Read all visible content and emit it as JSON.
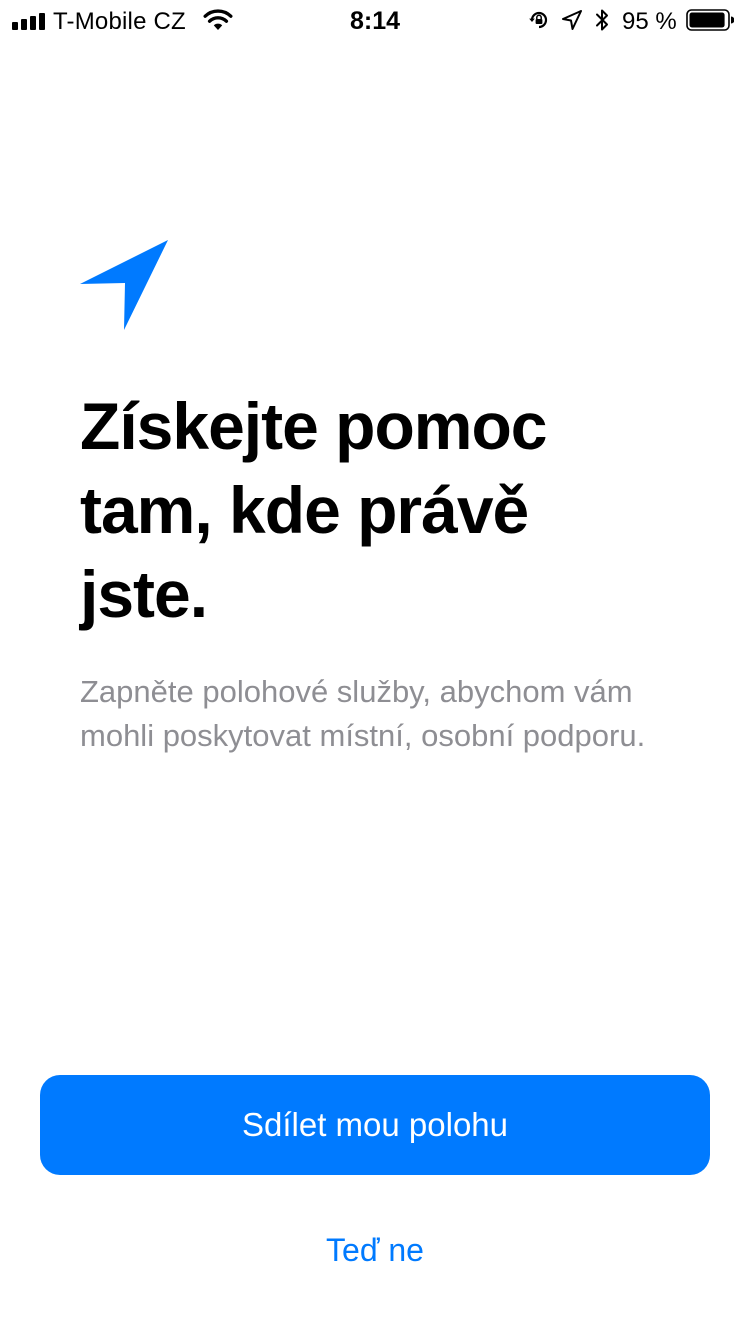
{
  "status_bar": {
    "carrier": "T-Mobile CZ",
    "time": "8:14",
    "battery_percent": "95 %",
    "battery_level": 0.95,
    "icons": [
      "cellular-signal-icon",
      "wifi-icon",
      "rotation-lock-icon",
      "location-arrow-icon",
      "bluetooth-icon",
      "battery-icon"
    ]
  },
  "content": {
    "icon": "location-arrow-icon",
    "icon_color": "#007aff",
    "headline": "Získejte pomoc tam, kde právě jste.",
    "description": "Zapněte polohové služby, abychom vám mohli poskytovat místní, osobní podporu."
  },
  "actions": {
    "primary_label": "Sdílet mou polohu",
    "secondary_label": "Teď ne",
    "accent_color": "#007aff"
  }
}
